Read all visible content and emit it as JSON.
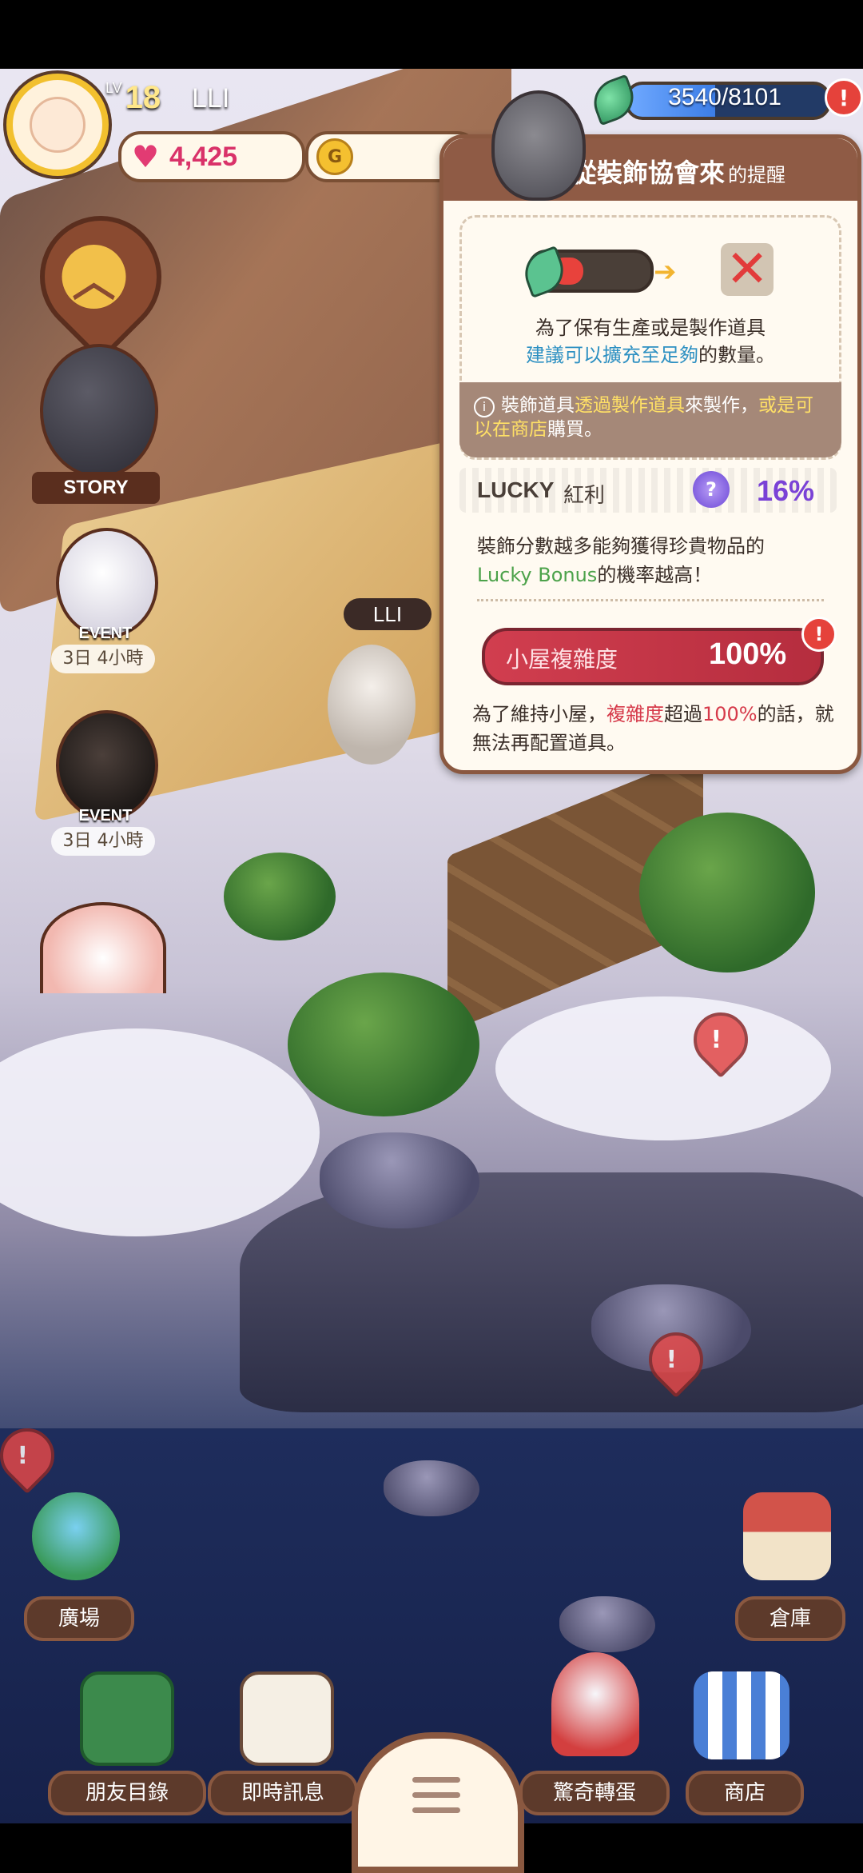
{
  "player": {
    "level_label": "LV",
    "level": "18",
    "name": "LLI"
  },
  "currency": {
    "hearts": "4,425",
    "coin_symbol": "G",
    "energy": "3540/8101",
    "energy_fraction": 0.437,
    "alert": "!"
  },
  "left_menu": {
    "story_label": "STORY",
    "events": [
      {
        "tag": "EVENT",
        "time": "3日 4小時"
      },
      {
        "tag": "EVENT",
        "time": "3日 4小時"
      }
    ]
  },
  "map_overlay": {
    "player_tag": "LLI",
    "pin_symbol": "!"
  },
  "popup": {
    "title": "從裝飾協會來",
    "title_suffix": "的提醒",
    "line1": "為了保有生產或是製作道具",
    "line2_highlight": "建議可以擴充至足夠",
    "line2_rest": "的數量。",
    "note_a": "裝飾道具",
    "note_b": "透過製作道具",
    "note_c": "來製作，",
    "note_d": "或是可以在商店",
    "note_e": "購買。",
    "lucky_label": "LUCKY",
    "lucky_cn": "紅利",
    "lucky_pct": "16%",
    "desc_line1": "裝飾分數越多能夠獲得珍貴物品的",
    "desc_line2_g": "Lucky Bonus",
    "desc_line2_rest": "的機率越高！",
    "complex_label": "小屋複雜度",
    "complex_value": "100%",
    "warn_a": "為了維持小屋，",
    "warn_b": "複雜度",
    "warn_c": "超過",
    "warn_d": "100%",
    "warn_e": "的話，就",
    "warn_line2": "無法再配置道具。"
  },
  "nav": {
    "plaza": "廣場",
    "storage": "倉庫",
    "friends": "朋友目錄",
    "messages": "即時訊息",
    "gacha": "驚奇轉蛋",
    "shop": "商店"
  },
  "colors": {
    "accent_brown": "#8a5840",
    "alert_red": "#e5423b",
    "lucky_purple": "#7a42d6",
    "highlight_blue": "#2d90c2"
  }
}
